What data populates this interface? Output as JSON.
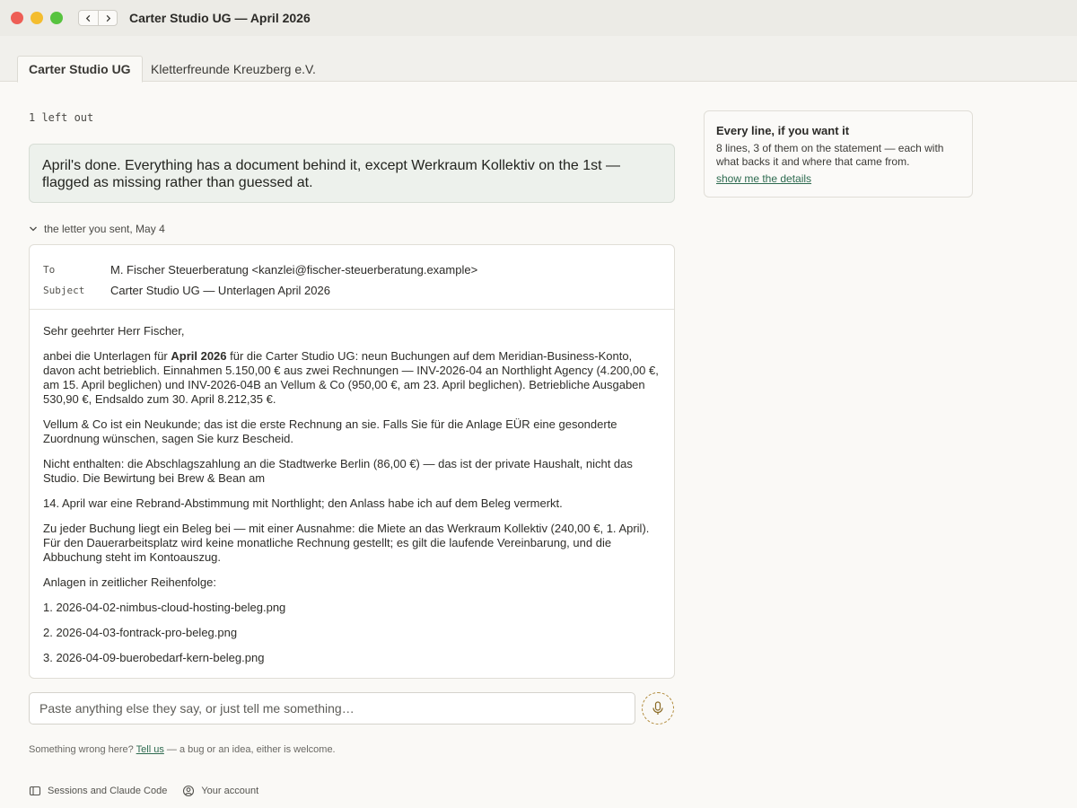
{
  "window": {
    "title": "Carter Studio UG — April 2026"
  },
  "tabs": [
    {
      "label": "Carter Studio UG",
      "active": true
    },
    {
      "label": "Kletterfreunde Kreuzberg e.V.",
      "active": false
    }
  ],
  "main": {
    "left_out": "1 left out",
    "summary": "April's done. Everything has a document behind it, except Werkraum Kollektiv on the 1st — flagged as missing rather than guessed at.",
    "disclosure_label": "the letter you sent, May 4"
  },
  "letter": {
    "to_label": "To",
    "to_value": "M. Fischer Steuerberatung <kanzlei@fischer-steuerberatung.example>",
    "subject_label": "Subject",
    "subject_value": "Carter Studio UG — Unterlagen April 2026",
    "greeting": "Sehr geehrter Herr Fischer,",
    "p1_pre": "anbei die Unterlagen für ",
    "p1_bold": "April 2026",
    "p1_post": " für die Carter Studio UG: neun Buchungen auf dem Meridian-Business-Konto, davon acht betrieblich. Einnahmen 5.150,00 € aus zwei Rechnungen — INV-2026-04 an Northlight Agency (4.200,00 €, am 15. April beglichen) und INV-2026-04B an Vellum & Co (950,00 €, am 23. April beglichen). Betriebliche Ausgaben 530,90 €, Endsaldo zum 30. April 8.212,35 €.",
    "p2": "Vellum & Co ist ein Neukunde; das ist die erste Rechnung an sie. Falls Sie für die Anlage EÜR eine gesonderte Zuordnung wünschen, sagen Sie kurz Bescheid.",
    "p3": "Nicht enthalten: die Abschlagszahlung an die Stadtwerke Berlin (86,00 €) — das ist der private Haushalt, nicht das Studio. Die Bewirtung bei Brew & Bean am",
    "p4": "14. April war eine Rebrand-Abstimmung mit Northlight; den Anlass habe ich auf dem Beleg vermerkt.",
    "p5": "Zu jeder Buchung liegt ein Beleg bei — mit einer Ausnahme: die Miete an das Werkraum Kollektiv (240,00 €, 1. April). Für den Dauerarbeitsplatz wird keine monatliche Rechnung gestellt; es gilt die laufende Vereinbarung, und die Abbuchung steht im Kontoauszug.",
    "p6": "Anlagen in zeitlicher Reihenfolge:",
    "attachments": [
      "1. 2026-04-02-nimbus-cloud-hosting-beleg.png",
      "2. 2026-04-03-fontrack-pro-beleg.png",
      "3. 2026-04-09-buerobedarf-kern-beleg.png"
    ]
  },
  "composer": {
    "placeholder": "Paste anything else they say, or just tell me something…"
  },
  "feedback": {
    "pre": "Something wrong here?",
    "link": "Tell us",
    "post": "— a bug or an idea, either is welcome."
  },
  "footer": {
    "sessions": "Sessions and Claude Code",
    "account": "Your account"
  },
  "card": {
    "title": "Every line, if you want it",
    "text": "8 lines, 3 of them on the statement — each with what backs it and where that came from.",
    "link": "show me the details"
  },
  "colors": {
    "accent_link": "#2d6a4f",
    "summary_bg": "#edf1ec",
    "mic_border": "#b08a3a"
  },
  "icons": [
    "back-icon",
    "forward-icon",
    "chevron-down-icon",
    "microphone-icon",
    "sidebar-icon",
    "account-icon"
  ]
}
